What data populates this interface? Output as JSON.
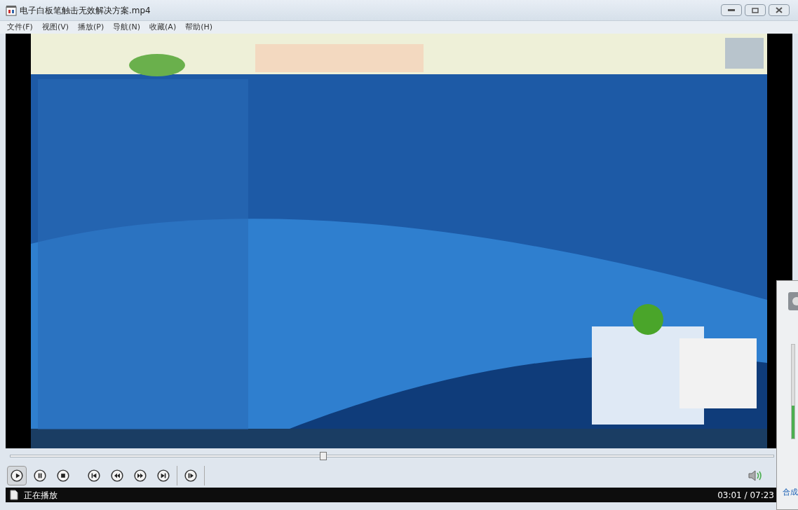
{
  "window": {
    "title": "电子白板笔触击无效解决方案.mp4"
  },
  "menu": [
    {
      "label": "文件(F)"
    },
    {
      "label": "视图(V)"
    },
    {
      "label": "播放(P)"
    },
    {
      "label": "导航(N)"
    },
    {
      "label": "收藏(A)"
    },
    {
      "label": "帮助(H)"
    }
  ],
  "seek": {
    "level": 0.41
  },
  "controls": [
    {
      "kind": "play",
      "selected": true
    },
    {
      "kind": "pause",
      "selected": false
    },
    {
      "kind": "stop",
      "selected": false
    },
    {
      "kind": "prev",
      "selected": false
    },
    {
      "kind": "rewind",
      "selected": false
    },
    {
      "kind": "forward",
      "selected": false
    },
    {
      "kind": "next",
      "selected": false
    },
    {
      "kind": "step",
      "selected": false
    }
  ],
  "status_bar": {
    "state": "正在播放",
    "time": "03:01 / 07:23"
  },
  "volume_popup": {
    "level": 0.35,
    "label": "合成"
  }
}
